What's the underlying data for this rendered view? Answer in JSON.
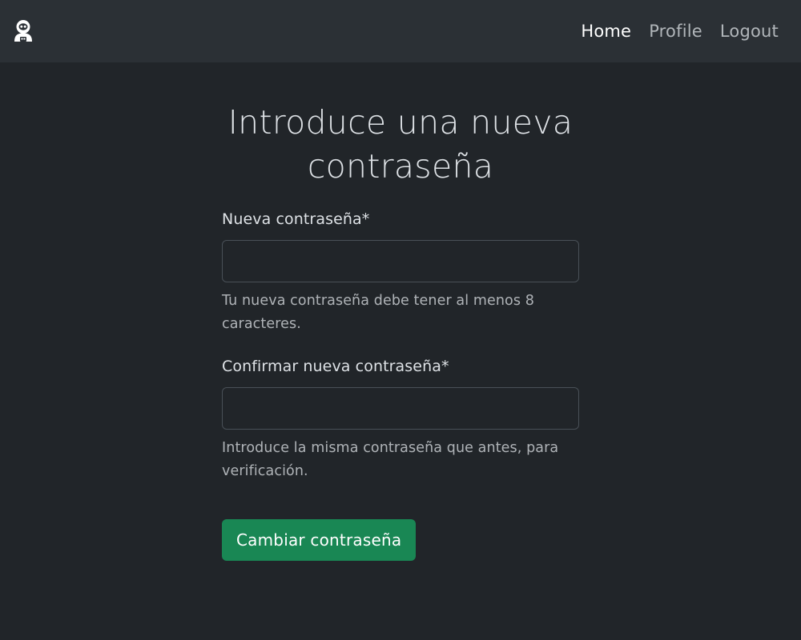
{
  "navbar": {
    "brand_icon": "robot-icon",
    "links": [
      {
        "label": "Home",
        "active": true
      },
      {
        "label": "Profile",
        "active": false
      },
      {
        "label": "Logout",
        "active": false
      }
    ]
  },
  "form": {
    "title": "Introduce una nueva contraseña",
    "new_password": {
      "label": "Nueva contraseña*",
      "value": "",
      "help": "Tu nueva contraseña debe tener al menos 8 caracteres."
    },
    "confirm_password": {
      "label": "Confirmar nueva contraseña*",
      "value": "",
      "help": "Introduce la misma contraseña que antes, para verificación."
    },
    "submit_label": "Cambiar contraseña"
  },
  "colors": {
    "background": "#212529",
    "navbar": "#2b3035",
    "primary_button": "#198754"
  }
}
